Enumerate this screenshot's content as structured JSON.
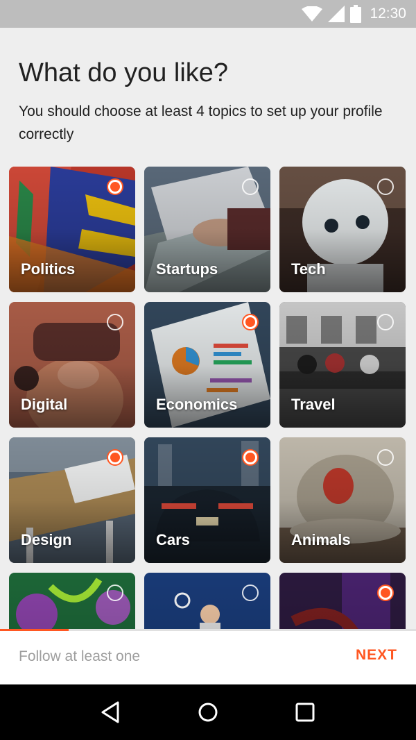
{
  "status_bar": {
    "time": "12:30",
    "icons": [
      "wifi-icon",
      "signal-icon",
      "battery-icon"
    ]
  },
  "header": {
    "title": "What do you like?",
    "subtitle": "You should choose at least 4 topics to set up your profile correctly"
  },
  "topics": [
    {
      "label": "Politics",
      "selected": true
    },
    {
      "label": "Startups",
      "selected": false
    },
    {
      "label": "Tech",
      "selected": false
    },
    {
      "label": "Digital",
      "selected": false
    },
    {
      "label": "Economics",
      "selected": true
    },
    {
      "label": "Travel",
      "selected": false
    },
    {
      "label": "Design",
      "selected": true
    },
    {
      "label": "Cars",
      "selected": true
    },
    {
      "label": "Animals",
      "selected": false
    },
    {
      "label": "",
      "selected": false
    },
    {
      "label": "",
      "selected": false
    },
    {
      "label": "",
      "selected": true
    }
  ],
  "footer": {
    "hint": "Follow at least one",
    "next_label": "NEXT",
    "progress": 0.165
  },
  "colors": {
    "accent": "#ff5722",
    "status_bar": "#bdbdbd",
    "background": "#eeeeee"
  },
  "nav_bar": {
    "icons": [
      "back-icon",
      "home-icon",
      "recents-icon"
    ]
  }
}
